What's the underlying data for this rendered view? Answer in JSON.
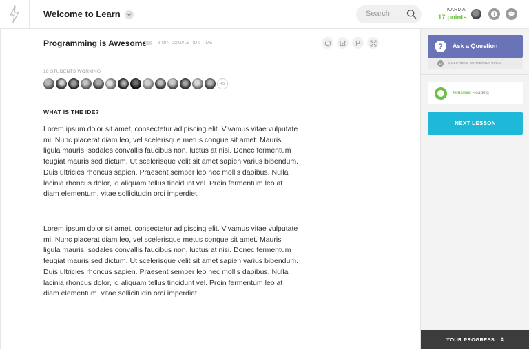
{
  "header": {
    "app_title": "Welcome to Learn",
    "search_placeholder": "Search",
    "karma_label": "KARMA",
    "karma_points": "17 points",
    "logo_icon": "bolt-icon",
    "info_icon": "info-icon",
    "chat_icon": "chat-icon"
  },
  "lesson": {
    "title": "Programming is Awesome",
    "completion_time": "3 MIN COMPLETION TIME",
    "tools": [
      "github-icon",
      "edit-icon",
      "flag-icon",
      "fullscreen-icon"
    ]
  },
  "students": {
    "label": "18 STUDENTS WORKING",
    "more": "+5",
    "avatar_count": 15
  },
  "content": {
    "heading": "WHAT IS THE IDE?",
    "paragraphs": [
      "Lorem ipsum dolor sit amet, consectetur adipiscing elit. Vivamus vitae vulputate mi. Nunc placerat diam leo, vel scelerisque metus congue sit amet. Mauris ligula mauris, sodales convallis faucibus non, luctus at nisi. Donec fermentum feugiat mauris sed dictum. Ut scelerisque velit sit amet sapien varius bibendum. Duis ultricies rhoncus sapien. Praesent semper leo nec mollis dapibus. Nulla lacinia rhoncus dolor, id aliquam tellus tincidunt vel. Proin fermentum leo at diam elementum, vitae sollicitudin orci imperdiet.",
      "Lorem ipsum dolor sit amet, consectetur adipiscing elit. Vivamus vitae vulputate mi. Nunc placerat diam leo, vel scelerisque metus congue sit amet. Mauris ligula mauris, sodales convallis faucibus non, luctus at nisi. Donec fermentum feugiat mauris sed dictum. Ut scelerisque velit sit amet sapien varius bibendum. Duis ultricies rhoncus sapien. Praesent semper leo nec mollis dapibus. Nulla lacinia rhoncus dolor, id aliquam tellus tincidunt vel. Proin fermentum leo at diam elementum, vitae sollicitudin orci imperdiet."
    ]
  },
  "sidebar": {
    "ask_label": "Ask a Question",
    "questions_count": "18",
    "questions_label": "QUESTIONS CURRENTLY OPEN",
    "status_finished": "Finished",
    "status_item": "Reading",
    "next_label": "NEXT LESSON",
    "progress_label": "YOUR PROGRESS"
  },
  "colors": {
    "accent_purple": "#6a73b8",
    "accent_cyan": "#1eb8d8",
    "accent_green": "#6cbf43",
    "progress_bg": "#3c3c3c"
  }
}
